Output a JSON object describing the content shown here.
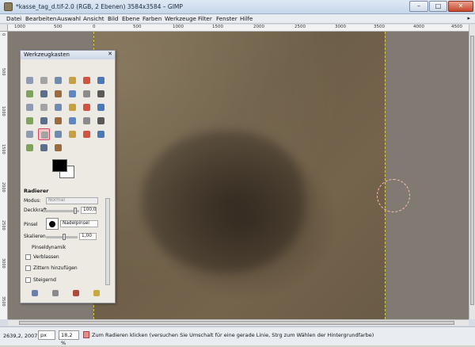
{
  "window": {
    "title": "*kasse_tag_d.tif-2.0 (RGB, 2 Ebenen) 3584x3584 – GIMP",
    "controls": [
      "–",
      "□",
      "✕"
    ]
  },
  "menu": [
    "Datei",
    "Bearbeiten",
    "Auswahl",
    "Ansicht",
    "Bild",
    "Ebene",
    "Farben",
    "Werkzeuge",
    "Filter",
    "Fenster",
    "Hilfe"
  ],
  "ruler": {
    "h_ticks": [
      "1000",
      "500",
      "0",
      "500",
      "1000",
      "1500",
      "2000",
      "2500",
      "3000",
      "3500",
      "4000",
      "4500"
    ],
    "v_ticks": [
      "0",
      "500",
      "1000",
      "1500",
      "2000",
      "2500",
      "3000",
      "3500"
    ]
  },
  "toolbox": {
    "title": "Werkzeugkasten",
    "close": "✕",
    "tool_icons": [
      "rect-select-icon",
      "ellipse-select-icon",
      "lasso-icon",
      "fuzzy-select-icon",
      "color-select-icon",
      "scissors-icon",
      "foreground-select-icon",
      "paths-icon",
      "color-picker-icon",
      "zoom-icon",
      "measure-icon",
      "move-icon",
      "align-icon",
      "crop-icon",
      "rotate-icon",
      "scale-icon",
      "shear-icon",
      "perspective-icon",
      "flip-icon",
      "cage-icon",
      "text-icon",
      "bucket-fill-icon",
      "blend-icon",
      "pencil-icon",
      "paintbrush-icon",
      "eraser-icon",
      "airbrush-icon",
      "ink-icon",
      "clone-icon",
      "heal-icon",
      "perspective-clone-icon",
      "smudge-icon",
      "dodge-burn-icon"
    ],
    "colors": {
      "fg": "#000000",
      "bg": "#ffffff"
    },
    "options": {
      "title": "Radierer",
      "mode_label": "Modus:",
      "mode_value": "Normal",
      "opacity_label": "Deckkraft",
      "opacity_value": "100,0",
      "brush_label": "Pinsel",
      "brush_value": "Nadelpinsel",
      "scale_label": "Skalieren",
      "scale_value": "1,00",
      "dynamics_label": "Pinseldynamik",
      "fade_label": "Verblassen",
      "jitter_label": "Zittern hinzufügen",
      "incremental_label": "Steigernd"
    }
  },
  "status": {
    "coords": "2639,2, 2007,8",
    "unit": "px",
    "zoom": "18,2 %",
    "message": "Zum Radieren klicken (versuchen Sie Umschalt für eine gerade Linie, Strg zum Wählen der Hintergrundfarbe)"
  }
}
